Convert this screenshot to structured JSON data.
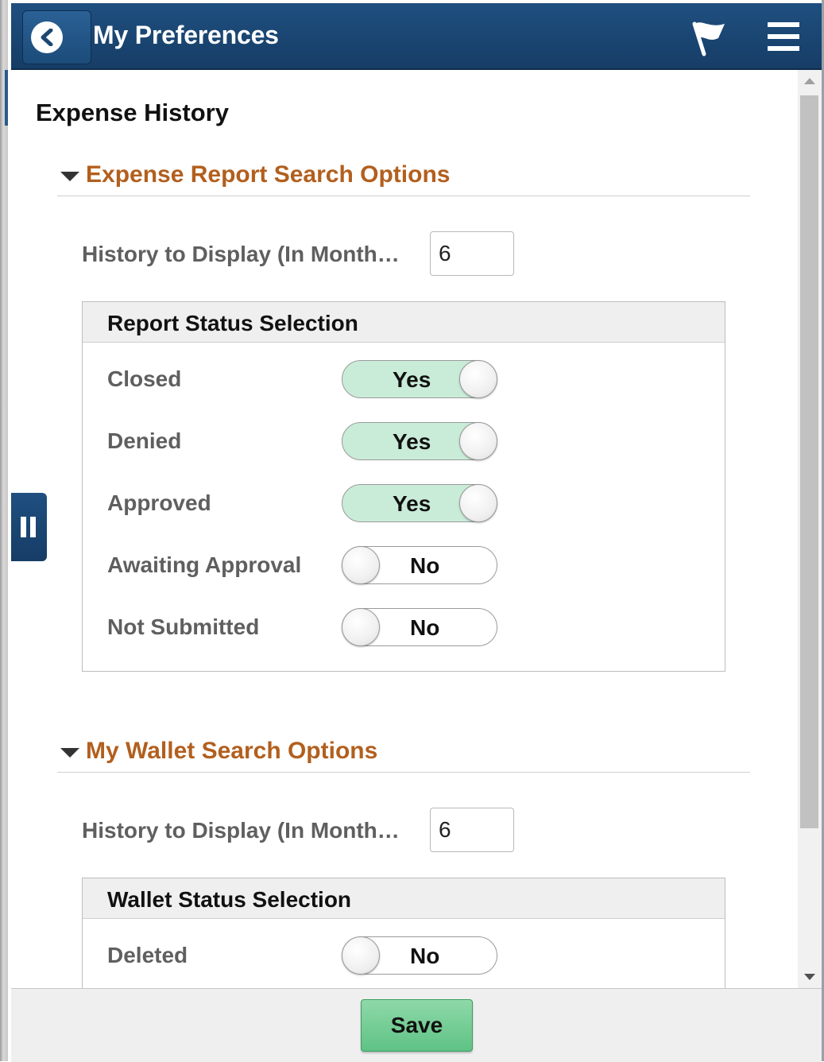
{
  "header": {
    "title": "My Preferences",
    "back_icon": "chevron-left-icon",
    "flag_icon": "flag-icon",
    "menu_icon": "hamburger-menu-icon"
  },
  "page": {
    "title": "Expense History"
  },
  "expense_section": {
    "title": "Expense Report Search Options",
    "history_label": "History to Display (In Month…",
    "history_value": "6",
    "group_title": "Report Status Selection",
    "statuses": [
      {
        "label": "Closed",
        "state": "Yes",
        "on": true
      },
      {
        "label": "Denied",
        "state": "Yes",
        "on": true
      },
      {
        "label": "Approved",
        "state": "Yes",
        "on": true
      },
      {
        "label": "Awaiting Approval",
        "state": "No",
        "on": false
      },
      {
        "label": "Not Submitted",
        "state": "No",
        "on": false
      }
    ]
  },
  "wallet_section": {
    "title": "My Wallet Search Options",
    "history_label": "History to Display (In Month…",
    "history_value": "6",
    "group_title": "Wallet Status Selection",
    "statuses": [
      {
        "label": "Deleted",
        "state": "No",
        "on": false
      }
    ]
  },
  "footer": {
    "save_label": "Save"
  },
  "colors": {
    "header_bg": "#1c4772",
    "section_title": "#b25f1e",
    "toggle_on": "#c9ecd8",
    "save_button": "#6fcb90"
  }
}
